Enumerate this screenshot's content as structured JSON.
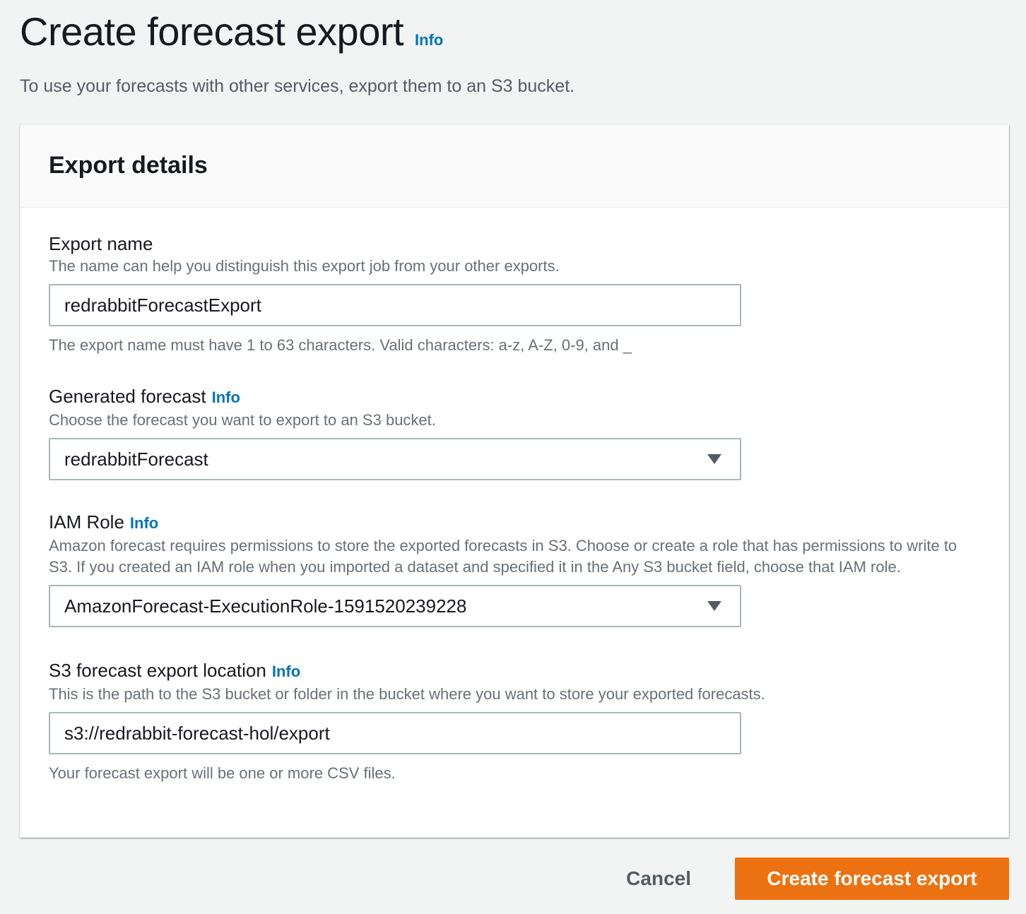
{
  "page": {
    "title": "Create forecast export",
    "info": "Info",
    "description": "To use your forecasts with other services, export them to an S3 bucket."
  },
  "panel": {
    "title": "Export details"
  },
  "fields": {
    "export_name": {
      "label": "Export name",
      "description": "The name can help you distinguish this export job from your other exports.",
      "value": "redrabbitForecastExport",
      "help": "The export name must have 1 to 63 characters. Valid characters: a-z, A-Z, 0-9, and _"
    },
    "generated_forecast": {
      "label": "Generated forecast",
      "info": "Info",
      "description": "Choose the forecast you want to export to an S3 bucket.",
      "value": "redrabbitForecast"
    },
    "iam_role": {
      "label": "IAM Role",
      "info": "Info",
      "description": "Amazon forecast requires permissions to store the exported forecasts in S3. Choose or create a role that has permissions to write to S3. If you created an IAM role when you imported a dataset and specified it in the Any S3 bucket field, choose that IAM role.",
      "value": "AmazonForecast-ExecutionRole-1591520239228"
    },
    "s3_location": {
      "label": "S3 forecast export location",
      "info": "Info",
      "description": "This is the path to the S3 bucket or folder in the bucket where you want to store your exported forecasts.",
      "value": "s3://redrabbit-forecast-hol/export",
      "help": "Your forecast export will be one or more CSV files."
    }
  },
  "actions": {
    "cancel": "Cancel",
    "submit": "Create forecast export"
  },
  "colors": {
    "primary": "#ec7211",
    "link": "#0073bb",
    "background": "#f2f3f3"
  },
  "icons": {
    "select_caret": "caret-down-icon"
  }
}
